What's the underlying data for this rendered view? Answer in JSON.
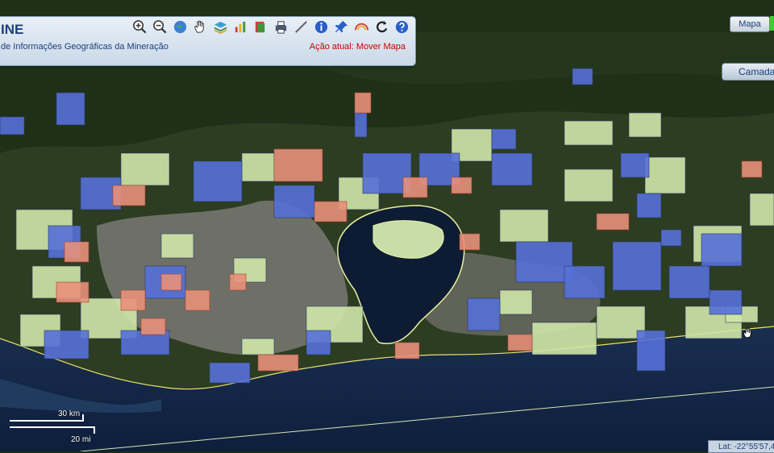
{
  "app": {
    "title": "INE",
    "subtitle": "de Informações Geográficas da Mineração",
    "action_status": "Ação atual: Mover Mapa"
  },
  "toolbar": {
    "tools": [
      {
        "icon": "zoom-in-icon"
      },
      {
        "icon": "zoom-out-icon"
      },
      {
        "icon": "globe-icon"
      },
      {
        "icon": "pan-hand-icon"
      },
      {
        "icon": "layers-stack-icon"
      },
      {
        "icon": "chart-icon"
      },
      {
        "icon": "book-icon"
      },
      {
        "icon": "print-icon"
      },
      {
        "icon": "measure-icon"
      },
      {
        "icon": "info-icon"
      },
      {
        "icon": "pin-icon"
      },
      {
        "icon": "rainbow-icon"
      },
      {
        "icon": "refresh-icon"
      },
      {
        "icon": "help-icon"
      }
    ]
  },
  "controls": {
    "map_button": "Mapa",
    "layers_button": "Camadas"
  },
  "scale": {
    "km": "30 km",
    "mi": "20 mi"
  },
  "coordinates": "Lat: -22°55'57,4"
}
